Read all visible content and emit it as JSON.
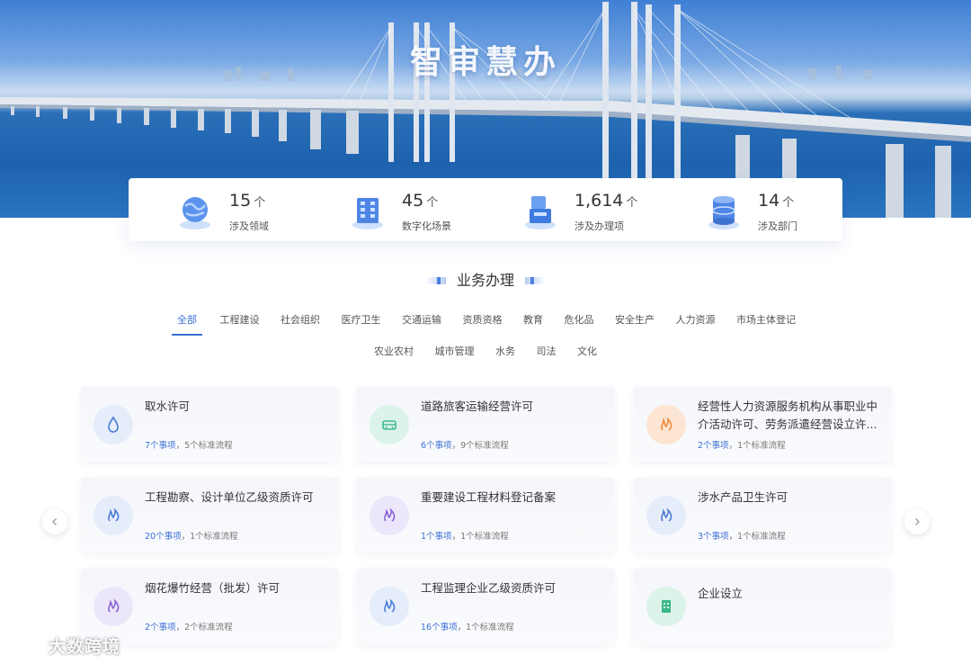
{
  "hero": {
    "title": "智审慧办"
  },
  "stats": [
    {
      "value": "15",
      "unit": "个",
      "label": "涉及领域",
      "icon": "globe-icon"
    },
    {
      "value": "45",
      "unit": "个",
      "label": "数字化场景",
      "icon": "building-icon"
    },
    {
      "value": "1,614",
      "unit": "个",
      "label": "涉及办理项",
      "icon": "kiosk-icon"
    },
    {
      "value": "14",
      "unit": "个",
      "label": "涉及部门",
      "icon": "database-icon"
    }
  ],
  "section": {
    "title": "业务办理"
  },
  "tabs_row1": [
    {
      "label": "全部",
      "active": true
    },
    {
      "label": "工程建设"
    },
    {
      "label": "社会组织"
    },
    {
      "label": "医疗卫生"
    },
    {
      "label": "交通运输"
    },
    {
      "label": "资质资格"
    },
    {
      "label": "教育"
    },
    {
      "label": "危化品"
    },
    {
      "label": "安全生产"
    },
    {
      "label": "人力资源"
    },
    {
      "label": "市场主体登记"
    }
  ],
  "tabs_row2": [
    {
      "label": "农业农村"
    },
    {
      "label": "城市管理"
    },
    {
      "label": "水务"
    },
    {
      "label": "司法"
    },
    {
      "label": "文化"
    }
  ],
  "cards": [
    {
      "title": "取水许可",
      "items": "7个事项",
      "flows": "5个标准流程",
      "icon": "water-drop-icon",
      "icon_bg": "#e6edfa",
      "icon_color": "#4a7bd6"
    },
    {
      "title": "道路旅客运输经营许可",
      "items": "6个事项",
      "flows": "9个标准流程",
      "icon": "car-icon",
      "icon_bg": "#dcf3ea",
      "icon_color": "#3bb88a"
    },
    {
      "title": "经营性人力资源服务机构从事职业中介活动许可、劳务派遣经营设立许...",
      "items": "2个事项",
      "flows": "1个标准流程",
      "icon": "flame-icon",
      "icon_bg": "#fde5d3",
      "icon_color": "#ee8a3c"
    },
    {
      "title": "工程勘察、设计单位乙级资质许可",
      "items": "20个事项",
      "flows": "1个标准流程",
      "icon": "flame-icon",
      "icon_bg": "#e6edfa",
      "icon_color": "#4a7bd6"
    },
    {
      "title": "重要建设工程材料登记备案",
      "items": "1个事项",
      "flows": "1个标准流程",
      "icon": "flame-icon",
      "icon_bg": "#ece6fa",
      "icon_color": "#8a62d6"
    },
    {
      "title": "涉水产品卫生许可",
      "items": "3个事项",
      "flows": "1个标准流程",
      "icon": "flame-icon",
      "icon_bg": "#e6edfa",
      "icon_color": "#4a7bd6"
    },
    {
      "title": "烟花爆竹经营（批发）许可",
      "items": "2个事项",
      "flows": "2个标准流程",
      "icon": "flame-icon",
      "icon_bg": "#ece6fa",
      "icon_color": "#8a62d6"
    },
    {
      "title": "工程监理企业乙级资质许可",
      "items": "16个事项",
      "flows": "1个标准流程",
      "icon": "flame-icon",
      "icon_bg": "#e6edfa",
      "icon_color": "#4a7bd6"
    },
    {
      "title": "企业设立",
      "items": "",
      "flows": "",
      "icon": "building-icon",
      "icon_bg": "#dcf3ea",
      "icon_color": "#3bb88a"
    }
  ],
  "watermark": {
    "text": "大数跨境"
  },
  "colors": {
    "accent": "#3b6fd6",
    "page_bg": "#ffffff"
  }
}
